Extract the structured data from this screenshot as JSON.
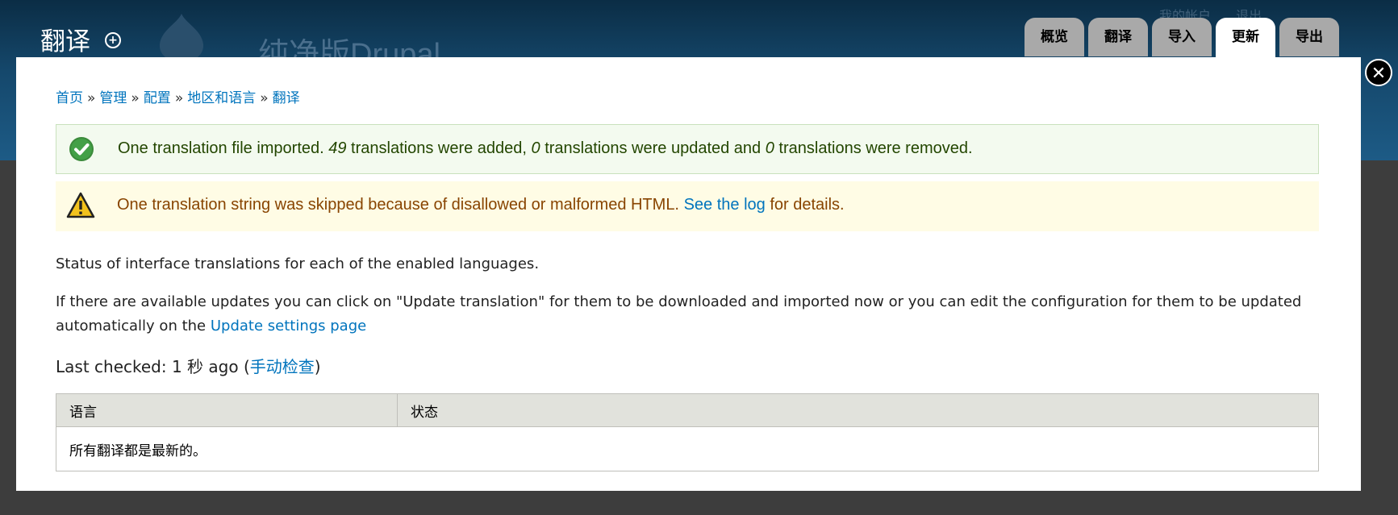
{
  "header": {
    "title": "翻译",
    "site_name": "纯净版Drupal",
    "top_links": [
      "我的帐户",
      "退出"
    ]
  },
  "tabs": [
    {
      "label": "概览",
      "active": false
    },
    {
      "label": "翻译",
      "active": false
    },
    {
      "label": "导入",
      "active": false
    },
    {
      "label": "更新",
      "active": true
    },
    {
      "label": "导出",
      "active": false
    }
  ],
  "breadcrumb": [
    "首页",
    "管理",
    "配置",
    "地区和语言",
    "翻译"
  ],
  "breadcrumb_sep": "»",
  "messages": {
    "status": {
      "part1": "One translation file imported. ",
      "added": "49",
      "part2": " translations were added, ",
      "updated": "0",
      "part3": " translations were updated and ",
      "removed": "0",
      "part4": " translations were removed."
    },
    "warning": {
      "text": "One translation string was skipped because of disallowed or malformed HTML. ",
      "link": "See the log",
      "after": " for details."
    }
  },
  "content": {
    "status_intro": "Status of interface translations for each of the enabled languages.",
    "updates_text": "If there are available updates you can click on \"Update translation\" for them to be downloaded and imported now or you can edit the configuration for them to be updated automatically on the ",
    "updates_link": "Update settings page",
    "last_checked_label": "Last checked: 1 秒 ago (",
    "manual_check": "手动检查",
    "last_checked_close": ")"
  },
  "table": {
    "headers": [
      "语言",
      "状态"
    ],
    "empty_text": "所有翻译都是最新的。"
  },
  "colors": {
    "link": "#0074bd",
    "status_bg": "#f3faef",
    "warning_bg": "#fffce5",
    "header_bg": "#15486c"
  },
  "icons": {
    "close": "close-icon",
    "status": "check-icon",
    "warning": "warning-icon",
    "add": "plus-circle-icon"
  }
}
